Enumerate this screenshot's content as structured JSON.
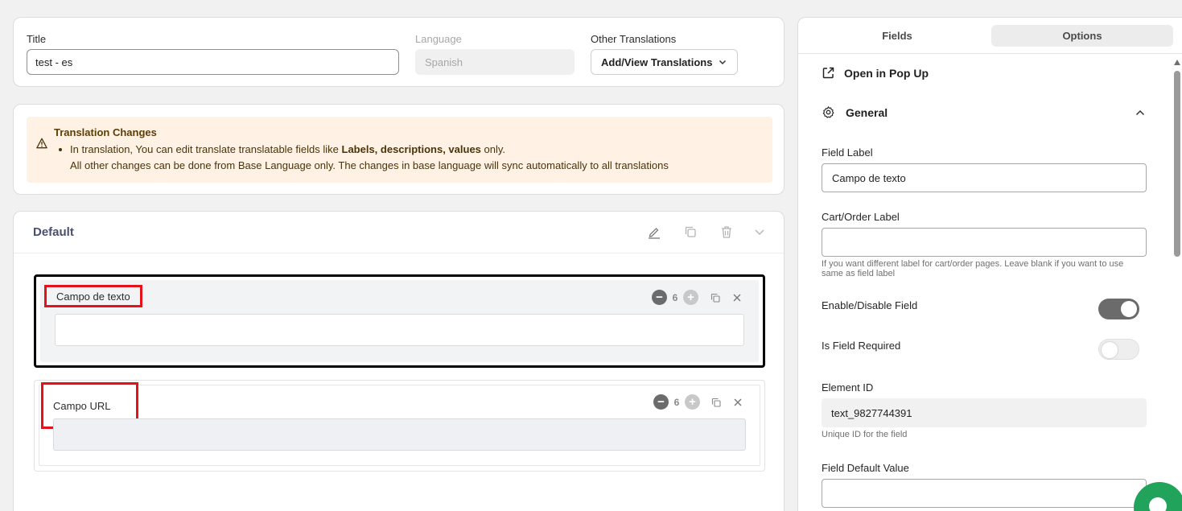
{
  "title_card": {
    "title_label": "Title",
    "title_value": "test - es",
    "language_label": "Language",
    "language_value": "Spanish",
    "other_translations_label": "Other Translations",
    "add_view_label": "Add/View Translations"
  },
  "notice": {
    "title": "Translation Changes",
    "line1_prefix": "In translation, You can edit translate translatable fields like ",
    "line1_bold": "Labels, descriptions, values",
    "line1_suffix": " only.",
    "line2": "All other changes can be done from Base Language only. The changes in base language will sync automatically to all translations"
  },
  "section": {
    "title": "Default",
    "fields": [
      {
        "label": "Campo de texto",
        "width": "6"
      },
      {
        "label": "Campo URL",
        "width": "6"
      }
    ]
  },
  "panel": {
    "tabs": [
      {
        "label": "Fields"
      },
      {
        "label": "Options"
      }
    ],
    "open_popup_label": "Open in Pop Up",
    "general_label": "General",
    "field_label_label": "Field Label",
    "field_label_value": "Campo de texto",
    "cart_label_label": "Cart/Order Label",
    "cart_label_value": "",
    "cart_label_help": "If you want different label for cart/order pages. Leave blank if you want to use same as field label",
    "enable_label": "Enable/Disable Field",
    "enable_on": true,
    "required_label": "Is Field Required",
    "required_on": false,
    "element_id_label": "Element ID",
    "element_id_value": "text_9827744391",
    "element_id_help": "Unique ID for the field",
    "default_value_label": "Field Default Value",
    "default_value_value": ""
  },
  "colors": {
    "highlight_red": "#e5121c",
    "notice_bg": "#fff1e3",
    "chat_green": "#22a35b",
    "toggle_on": "#6b6b6b"
  },
  "icons": [
    "warning-icon",
    "edit-icon",
    "copy-icon",
    "trash-icon",
    "chevron-down-icon",
    "minus-icon",
    "plus-icon",
    "close-icon",
    "external-link-icon",
    "gear-icon",
    "chevron-up-icon",
    "chat-icon"
  ]
}
